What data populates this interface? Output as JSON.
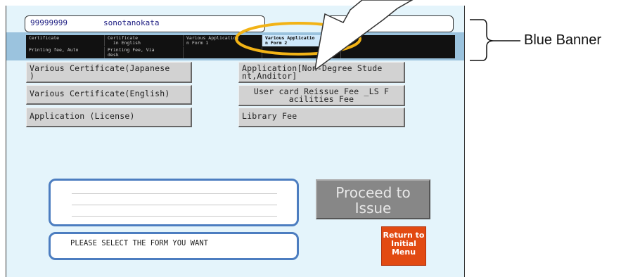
{
  "header": {
    "user_id": "99999999",
    "user_name": "sonotanokata"
  },
  "tabs": {
    "row1": [
      "Certificate",
      "Certificate\n  in English",
      "Various Application\nn Form 1",
      "Various Applicatio\nn Form 2",
      ""
    ],
    "row2": [
      "Printing fee, Auto",
      "Printing Fee, Via\ndesk",
      "",
      "",
      ""
    ]
  },
  "forms": {
    "left": [
      "Various Certificate(Japanese\n)",
      "Various Certificate(English)",
      "Application (License)"
    ],
    "right": [
      "Application[Non-Degree Stude\nnt,Anditor]",
      "User card Reissue Fee _LS F\nacilities Fee",
      "Library Fee"
    ]
  },
  "status": {
    "message": "PLEASE SELECT THE FORM YOU WANT"
  },
  "buttons": {
    "proceed": "Proceed to\nIssue",
    "return": "Return to\nInitial\nMenu"
  },
  "annotation": {
    "label": "Blue Banner"
  },
  "colors": {
    "screen_bg": "#e4f4fb",
    "banner": "#9bc3de",
    "tab_bar": "#111111",
    "active_tab": "#cfe8fb",
    "frame_blue": "#4c7dc0",
    "return_button": "#e24a12",
    "highlight_ellipse": "#f2b316"
  }
}
